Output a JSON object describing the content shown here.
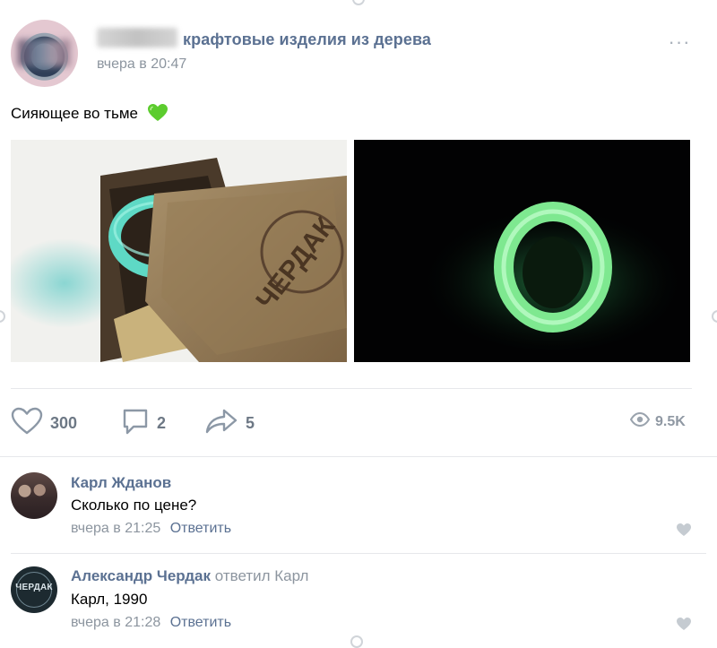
{
  "post": {
    "group_name": "крафтовые изделия из дерева",
    "time": "вчера в 20:47",
    "text": "Сияющее во тьме",
    "more_label": "···",
    "photos": [
      {
        "subject": "wooden box with ring"
      },
      {
        "subject": "glowing ring in the dark"
      }
    ],
    "box_lid_text": "ЧЕРДАК",
    "actions": {
      "likes": "300",
      "comments": "2",
      "shares": "5",
      "views": "9.5K"
    }
  },
  "comments": [
    {
      "author": "Карл Жданов",
      "reply_to": "",
      "text": "Сколько по цене?",
      "time": "вчера в 21:25",
      "reply_label": "Ответить"
    },
    {
      "author": "Александр Чердак",
      "reply_to": "ответил Карл",
      "avatar_text": "ЧЕРДАК",
      "text": "Карл, 1990",
      "time": "вчера в 21:28",
      "reply_label": "Ответить"
    }
  ],
  "icons": {
    "heart": "heart-icon",
    "comment": "comment-icon",
    "share": "share-icon",
    "views": "eye-icon",
    "green_heart": "green-heart-emoji"
  },
  "colors": {
    "link": "#5b7192",
    "meta": "#8c959f",
    "action": "#6d7885",
    "glow": "#8df5a2"
  }
}
